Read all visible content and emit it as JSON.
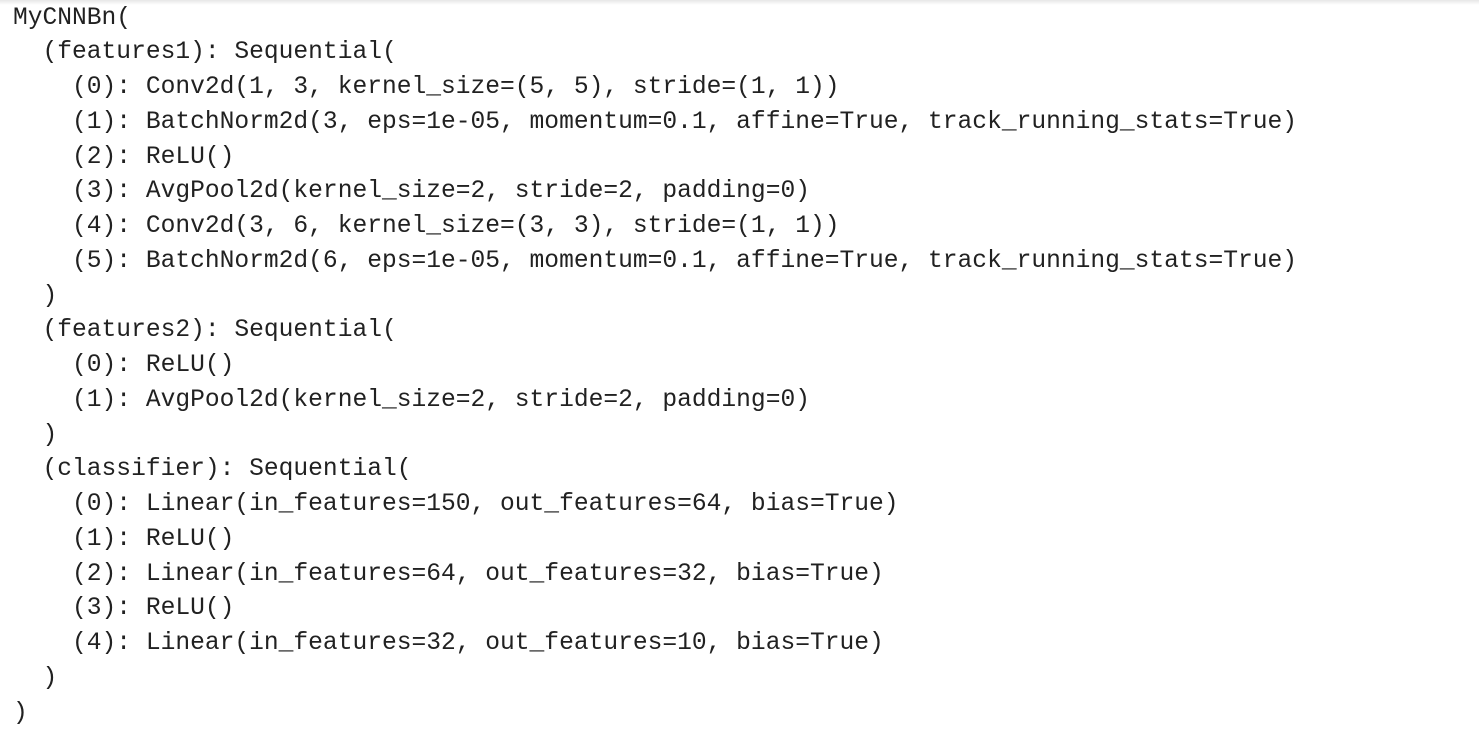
{
  "output": {
    "lines": [
      "MyCNNBn(",
      "  (features1): Sequential(",
      "    (0): Conv2d(1, 3, kernel_size=(5, 5), stride=(1, 1))",
      "    (1): BatchNorm2d(3, eps=1e-05, momentum=0.1, affine=True, track_running_stats=True)",
      "    (2): ReLU()",
      "    (3): AvgPool2d(kernel_size=2, stride=2, padding=0)",
      "    (4): Conv2d(3, 6, kernel_size=(3, 3), stride=(1, 1))",
      "    (5): BatchNorm2d(6, eps=1e-05, momentum=0.1, affine=True, track_running_stats=True)",
      "  )",
      "  (features2): Sequential(",
      "    (0): ReLU()",
      "    (1): AvgPool2d(kernel_size=2, stride=2, padding=0)",
      "  )",
      "  (classifier): Sequential(",
      "    (0): Linear(in_features=150, out_features=64, bias=True)",
      "    (1): ReLU()",
      "    (2): Linear(in_features=64, out_features=32, bias=True)",
      "    (3): ReLU()",
      "    (4): Linear(in_features=32, out_features=10, bias=True)",
      "  )",
      ")"
    ]
  }
}
